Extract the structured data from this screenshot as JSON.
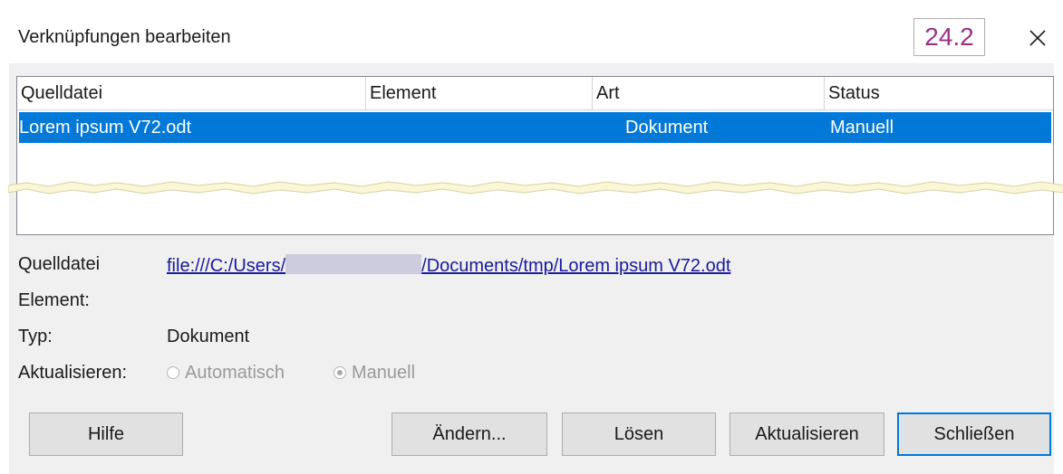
{
  "window": {
    "title": "Verknüpfungen bearbeiten",
    "version_badge": "24.2",
    "close_icon": "close-icon"
  },
  "table": {
    "columns": [
      "Quelldatei",
      "Element",
      "Art",
      "Status"
    ],
    "rows": [
      {
        "source": "Lorem ipsum V72.odt",
        "element": "",
        "type": "Dokument",
        "status": "Manuell"
      }
    ],
    "selection_color": "#0078d7"
  },
  "details": {
    "source_label": "Quelldatei",
    "source_link_prefix": "file:///C:/Users/",
    "source_link_suffix": "/Documents/tmp/Lorem ipsum V72.odt",
    "element_label": "Element:",
    "type_label": "Typ:",
    "type_value": "Dokument",
    "update_label": "Aktualisieren:",
    "update_options": [
      {
        "label": "Automatisch",
        "checked": false,
        "enabled": false
      },
      {
        "label": "Manuell",
        "checked": true,
        "enabled": false
      }
    ]
  },
  "buttons": {
    "help": "Hilfe",
    "edit": "Ändern...",
    "release": "Lösen",
    "refresh": "Aktualisieren",
    "close": "Schließen"
  },
  "colors": {
    "accent": "#0078d7",
    "badge_text": "#9b2f87",
    "link": "#1a1a9c",
    "dialog_bg": "#f0f0f0"
  }
}
